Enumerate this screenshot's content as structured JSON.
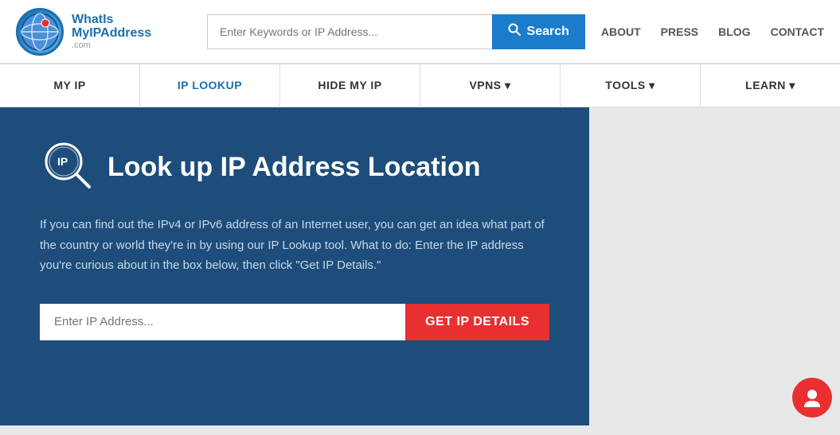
{
  "header": {
    "logo": {
      "what": "What",
      "is": "Is",
      "myip": "MyIP",
      "address": "Address",
      "com": ".com"
    },
    "search": {
      "placeholder": "Enter Keywords or IP Address...",
      "button_label": "Search"
    },
    "nav_links": [
      {
        "label": "ABOUT"
      },
      {
        "label": "PRESS"
      },
      {
        "label": "BLOG"
      },
      {
        "label": "CONTACT"
      }
    ]
  },
  "navbar": {
    "items": [
      {
        "label": "MY IP"
      },
      {
        "label": "IP LOOKUP"
      },
      {
        "label": "HIDE MY IP"
      },
      {
        "label": "VPNS ▾"
      },
      {
        "label": "TOOLS ▾"
      },
      {
        "label": "LEARN ▾"
      }
    ]
  },
  "hero": {
    "title": "Look up IP Address Location",
    "description": "If you can find out the IPv4 or IPv6 address of an Internet user, you can get an idea what part of the country or world they're in by using our IP Lookup tool. What to do: Enter the IP address you're curious about in the box below, then click \"Get IP Details.\"",
    "ip_input_placeholder": "Enter IP Address...",
    "button_label": "GET IP DETAILS"
  }
}
